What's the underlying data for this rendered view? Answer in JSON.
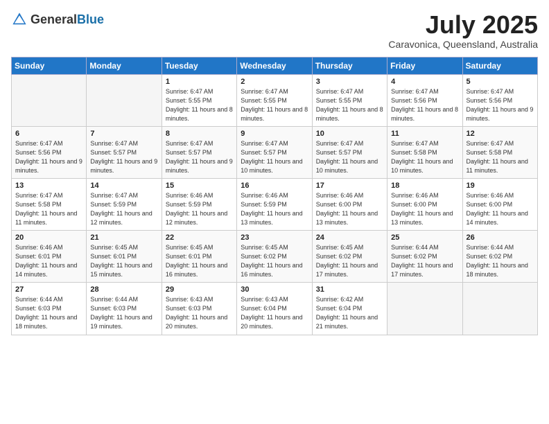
{
  "header": {
    "logo_general": "General",
    "logo_blue": "Blue",
    "month": "July 2025",
    "location": "Caravonica, Queensland, Australia"
  },
  "weekdays": [
    "Sunday",
    "Monday",
    "Tuesday",
    "Wednesday",
    "Thursday",
    "Friday",
    "Saturday"
  ],
  "weeks": [
    [
      {
        "day": "",
        "info": ""
      },
      {
        "day": "",
        "info": ""
      },
      {
        "day": "1",
        "info": "Sunrise: 6:47 AM\nSunset: 5:55 PM\nDaylight: 11 hours and 8 minutes."
      },
      {
        "day": "2",
        "info": "Sunrise: 6:47 AM\nSunset: 5:55 PM\nDaylight: 11 hours and 8 minutes."
      },
      {
        "day": "3",
        "info": "Sunrise: 6:47 AM\nSunset: 5:55 PM\nDaylight: 11 hours and 8 minutes."
      },
      {
        "day": "4",
        "info": "Sunrise: 6:47 AM\nSunset: 5:56 PM\nDaylight: 11 hours and 8 minutes."
      },
      {
        "day": "5",
        "info": "Sunrise: 6:47 AM\nSunset: 5:56 PM\nDaylight: 11 hours and 9 minutes."
      }
    ],
    [
      {
        "day": "6",
        "info": "Sunrise: 6:47 AM\nSunset: 5:56 PM\nDaylight: 11 hours and 9 minutes."
      },
      {
        "day": "7",
        "info": "Sunrise: 6:47 AM\nSunset: 5:57 PM\nDaylight: 11 hours and 9 minutes."
      },
      {
        "day": "8",
        "info": "Sunrise: 6:47 AM\nSunset: 5:57 PM\nDaylight: 11 hours and 9 minutes."
      },
      {
        "day": "9",
        "info": "Sunrise: 6:47 AM\nSunset: 5:57 PM\nDaylight: 11 hours and 10 minutes."
      },
      {
        "day": "10",
        "info": "Sunrise: 6:47 AM\nSunset: 5:57 PM\nDaylight: 11 hours and 10 minutes."
      },
      {
        "day": "11",
        "info": "Sunrise: 6:47 AM\nSunset: 5:58 PM\nDaylight: 11 hours and 10 minutes."
      },
      {
        "day": "12",
        "info": "Sunrise: 6:47 AM\nSunset: 5:58 PM\nDaylight: 11 hours and 11 minutes."
      }
    ],
    [
      {
        "day": "13",
        "info": "Sunrise: 6:47 AM\nSunset: 5:58 PM\nDaylight: 11 hours and 11 minutes."
      },
      {
        "day": "14",
        "info": "Sunrise: 6:47 AM\nSunset: 5:59 PM\nDaylight: 11 hours and 12 minutes."
      },
      {
        "day": "15",
        "info": "Sunrise: 6:46 AM\nSunset: 5:59 PM\nDaylight: 11 hours and 12 minutes."
      },
      {
        "day": "16",
        "info": "Sunrise: 6:46 AM\nSunset: 5:59 PM\nDaylight: 11 hours and 13 minutes."
      },
      {
        "day": "17",
        "info": "Sunrise: 6:46 AM\nSunset: 6:00 PM\nDaylight: 11 hours and 13 minutes."
      },
      {
        "day": "18",
        "info": "Sunrise: 6:46 AM\nSunset: 6:00 PM\nDaylight: 11 hours and 13 minutes."
      },
      {
        "day": "19",
        "info": "Sunrise: 6:46 AM\nSunset: 6:00 PM\nDaylight: 11 hours and 14 minutes."
      }
    ],
    [
      {
        "day": "20",
        "info": "Sunrise: 6:46 AM\nSunset: 6:01 PM\nDaylight: 11 hours and 14 minutes."
      },
      {
        "day": "21",
        "info": "Sunrise: 6:45 AM\nSunset: 6:01 PM\nDaylight: 11 hours and 15 minutes."
      },
      {
        "day": "22",
        "info": "Sunrise: 6:45 AM\nSunset: 6:01 PM\nDaylight: 11 hours and 16 minutes."
      },
      {
        "day": "23",
        "info": "Sunrise: 6:45 AM\nSunset: 6:02 PM\nDaylight: 11 hours and 16 minutes."
      },
      {
        "day": "24",
        "info": "Sunrise: 6:45 AM\nSunset: 6:02 PM\nDaylight: 11 hours and 17 minutes."
      },
      {
        "day": "25",
        "info": "Sunrise: 6:44 AM\nSunset: 6:02 PM\nDaylight: 11 hours and 17 minutes."
      },
      {
        "day": "26",
        "info": "Sunrise: 6:44 AM\nSunset: 6:02 PM\nDaylight: 11 hours and 18 minutes."
      }
    ],
    [
      {
        "day": "27",
        "info": "Sunrise: 6:44 AM\nSunset: 6:03 PM\nDaylight: 11 hours and 18 minutes."
      },
      {
        "day": "28",
        "info": "Sunrise: 6:44 AM\nSunset: 6:03 PM\nDaylight: 11 hours and 19 minutes."
      },
      {
        "day": "29",
        "info": "Sunrise: 6:43 AM\nSunset: 6:03 PM\nDaylight: 11 hours and 20 minutes."
      },
      {
        "day": "30",
        "info": "Sunrise: 6:43 AM\nSunset: 6:04 PM\nDaylight: 11 hours and 20 minutes."
      },
      {
        "day": "31",
        "info": "Sunrise: 6:42 AM\nSunset: 6:04 PM\nDaylight: 11 hours and 21 minutes."
      },
      {
        "day": "",
        "info": ""
      },
      {
        "day": "",
        "info": ""
      }
    ]
  ]
}
